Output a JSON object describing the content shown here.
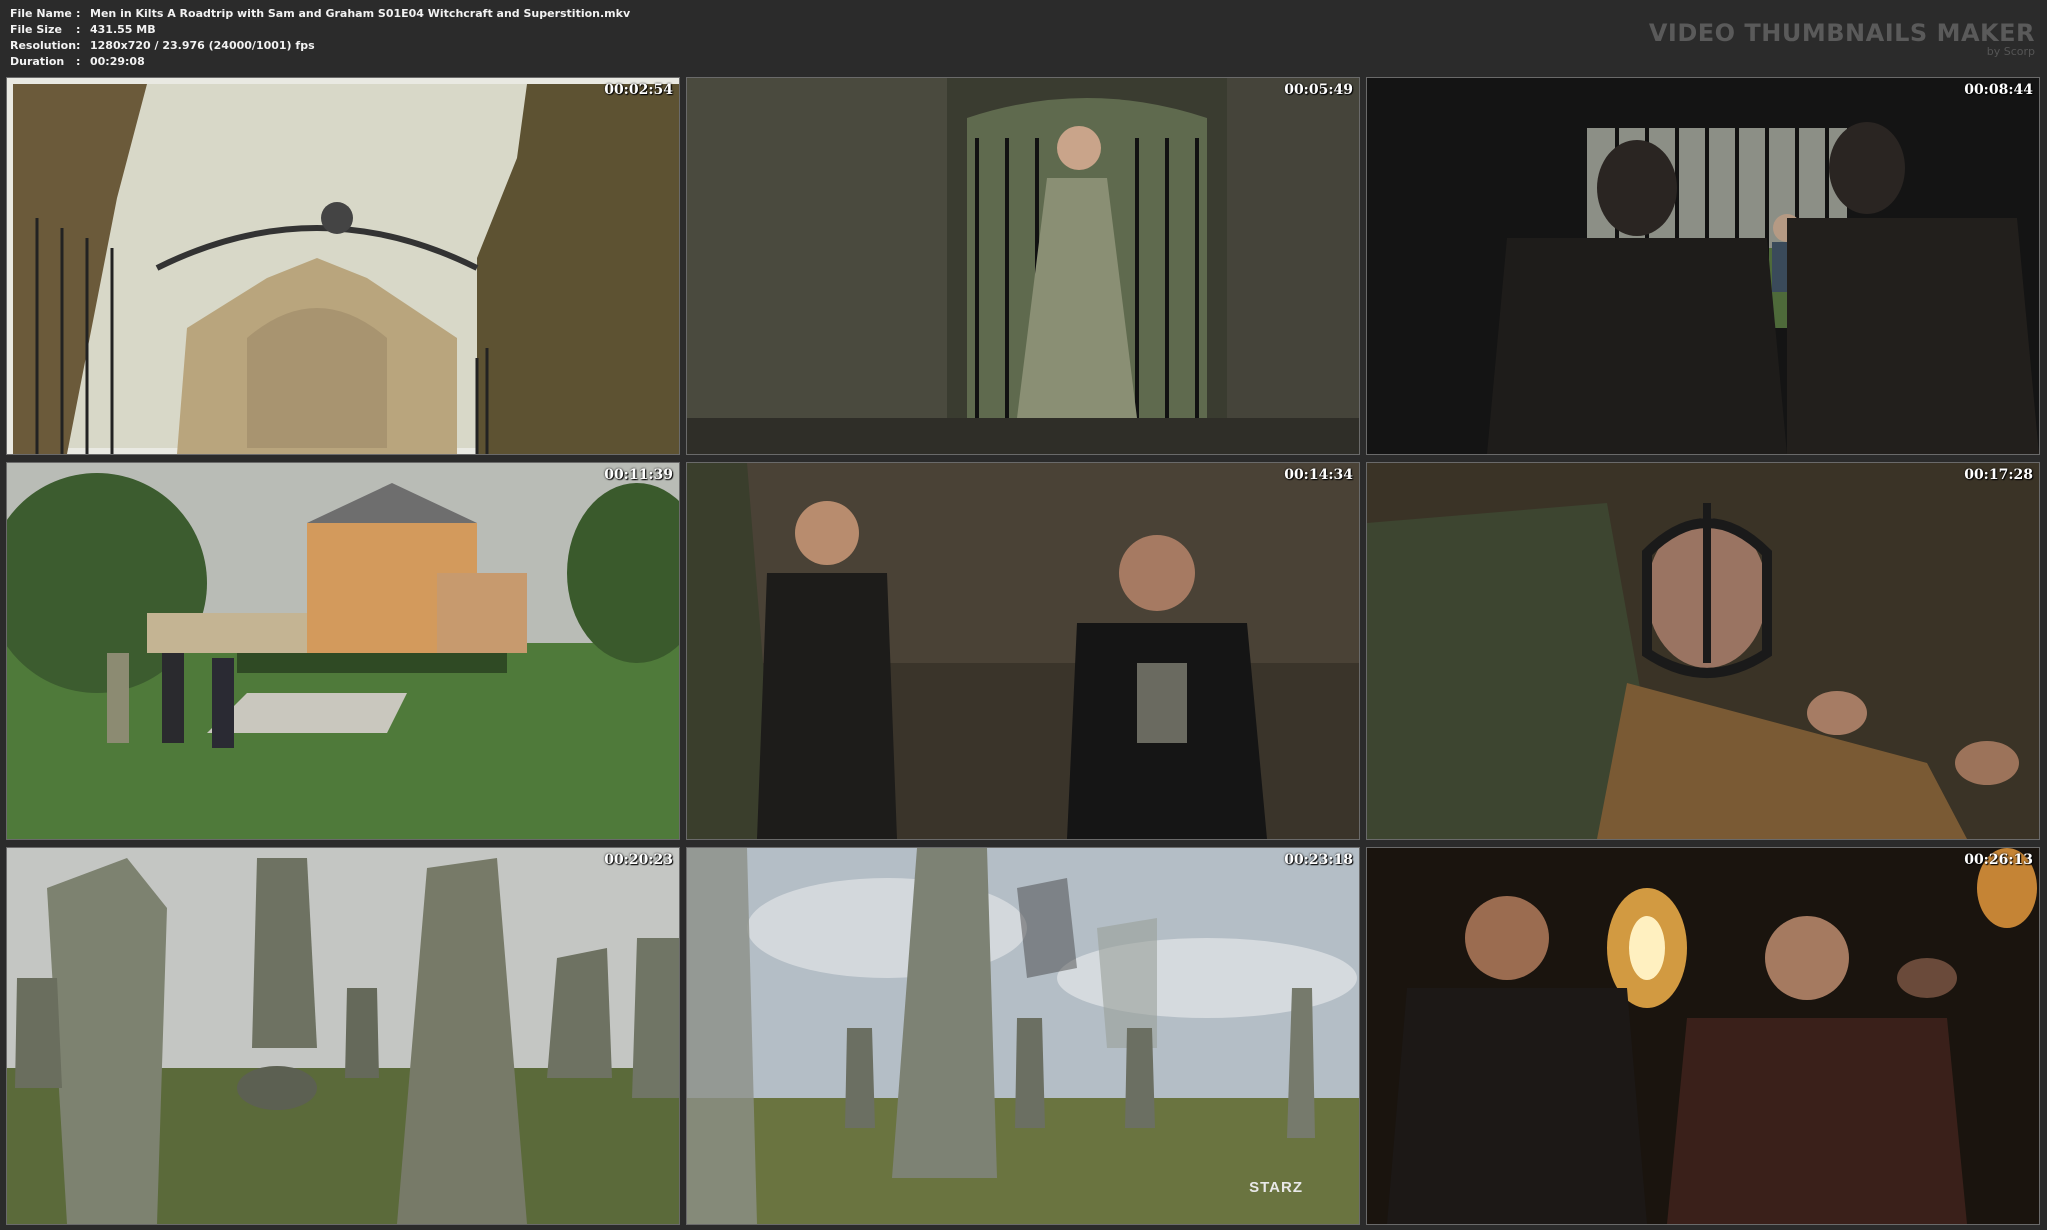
{
  "file_info": {
    "rows": [
      {
        "key": "File Name",
        "value": "Men in Kilts A Roadtrip with Sam and Graham S01E04 Witchcraft and Superstition.mkv"
      },
      {
        "key": "File Size",
        "value": "431.55 MB"
      },
      {
        "key": "Resolution",
        "value": "1280x720 / 23.976 (24000/1001) fps"
      },
      {
        "key": "Duration",
        "value": "00:29:08"
      }
    ],
    "separator": ":"
  },
  "brand": {
    "title": "VIDEO THUMBNAILS MAKER",
    "subtitle": "by Scorp"
  },
  "thumbnails": [
    {
      "timestamp": "00:02:54",
      "scene": "gate-painting-icon"
    },
    {
      "timestamp": "00:05:49",
      "scene": "man-at-gate-icon"
    },
    {
      "timestamp": "00:08:44",
      "scene": "dark-window-icon"
    },
    {
      "timestamp": "00:11:39",
      "scene": "castle-lawn-icon"
    },
    {
      "timestamp": "00:14:34",
      "scene": "vault-men-icon"
    },
    {
      "timestamp": "00:17:28",
      "scene": "iron-mask-icon"
    },
    {
      "timestamp": "00:20:23",
      "scene": "standing-stones-icon"
    },
    {
      "timestamp": "00:23:18",
      "scene": "stones-overlay-icon"
    },
    {
      "timestamp": "00:26:13",
      "scene": "torchlight-icon"
    }
  ],
  "watermark": "STARZ",
  "colors": {
    "background": "#2b2b2b",
    "text": "#f2f2f2",
    "brand": "#5a5a5a"
  }
}
